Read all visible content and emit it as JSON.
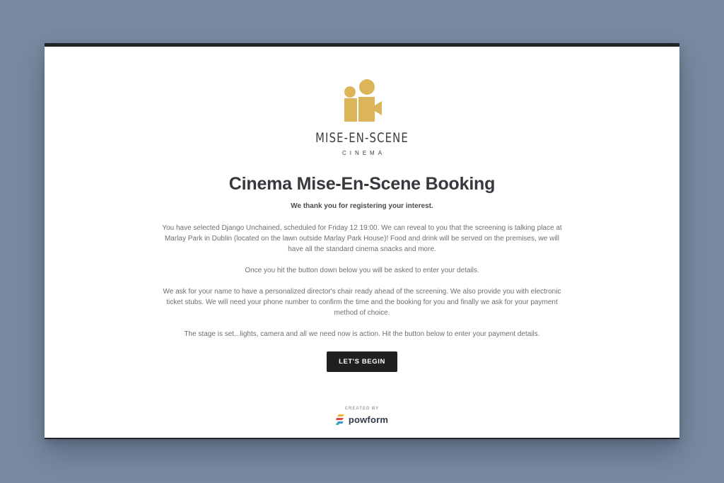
{
  "brand": {
    "name": "MISE-EN-SCENE",
    "subtitle": "CINEMA",
    "logo_icon": "camera-people-icon",
    "logo_color": "#dcb55b"
  },
  "main": {
    "title": "Cinema Mise-En-Scene Booking",
    "thanks": "We thank you for registering your interest.",
    "paragraphs": [
      "You have selected Django Unchained, scheduled for Friday 12 19:00. We can reveal to you that the screening is talking place at Marlay Park in Dublin (located on the lawn outside Marlay Park House)! Food and drink will be served on the premises, we will have all the standard cinema snacks and more.",
      "Once you hit the button down below you will be asked to enter your details.",
      "We ask for your name to have a personalized director's chair ready ahead of the screening. We also provide you with electronic ticket stubs. We will need your phone number to confirm the time and the booking for you and finally we ask for your payment method of choice.",
      "The stage is set...lights, camera and all we need now is action. Hit the button below to enter your payment details."
    ],
    "cta_label": "LET'S BEGIN"
  },
  "footer": {
    "created_by": "CREATED BY",
    "powered_name": "powform",
    "powered_icon": "powform-logo-icon"
  },
  "colors": {
    "background": "#7a8aa1",
    "card": "#ffffff",
    "button": "#1f2022",
    "accent_gold": "#dcb55b"
  }
}
